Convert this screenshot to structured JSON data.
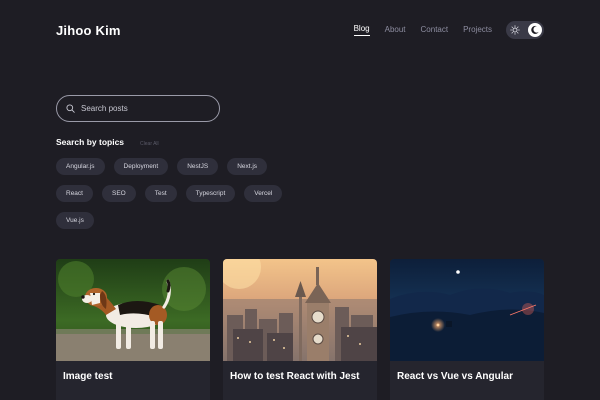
{
  "header": {
    "brand": "Jihoo Kim",
    "nav": [
      {
        "label": "Blog",
        "active": true
      },
      {
        "label": "About",
        "active": false
      },
      {
        "label": "Contact",
        "active": false
      },
      {
        "label": "Projects",
        "active": false
      }
    ],
    "theme_toggle": {
      "left_icon": "sun-icon",
      "right_icon": "moon-icon",
      "mode": "dark"
    }
  },
  "search": {
    "placeholder": "Search posts",
    "value": ""
  },
  "topics": {
    "title": "Search by topics",
    "clear_label": "Clear All",
    "rows": [
      [
        "Angular.js",
        "Deployment",
        "NestJS",
        "Next.js"
      ],
      [
        "React",
        "SEO",
        "Test",
        "Typescript",
        "Vercel"
      ],
      [
        "Vue.js"
      ]
    ]
  },
  "posts": [
    {
      "title": "Image test",
      "image": "dog-photo"
    },
    {
      "title": "How to test React with Jest",
      "image": "city-photo"
    },
    {
      "title": "React vs Vue vs Angular",
      "image": "night-photo"
    }
  ],
  "colors": {
    "background": "#1e1d24",
    "tag_background": "#2f2f3b",
    "card_background": "#25252e",
    "text_primary": "#ffffff",
    "text_muted": "#8d8da0"
  }
}
